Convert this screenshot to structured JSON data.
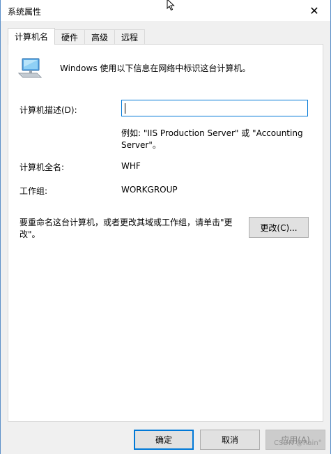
{
  "window": {
    "title": "系统属性",
    "close_glyph": "✕"
  },
  "tabs": [
    {
      "label": "计算机名",
      "active": true
    },
    {
      "label": "硬件",
      "active": false
    },
    {
      "label": "高级",
      "active": false
    },
    {
      "label": "远程",
      "active": false
    }
  ],
  "computer_name_tab": {
    "intro": "Windows 使用以下信息在网络中标识这台计算机。",
    "description_label": "计算机描述(D):",
    "description_value": "",
    "example_text": "例如: \"IIS Production Server\" 或 \"Accounting Server\"。",
    "full_name_label": "计算机全名:",
    "full_name_value": "WHF",
    "workgroup_label": "工作组:",
    "workgroup_value": "WORKGROUP",
    "rename_text": "要重命名这台计算机，或者更改其域或工作组，请单击\"更改\"。",
    "change_button": "更改(C)..."
  },
  "footer": {
    "ok_button": "确定",
    "cancel_button": "取消",
    "apply_button": "应用(A)",
    "apply_enabled": false,
    "watermark": "CSDN @Rain°"
  },
  "colors": {
    "focus_border": "#0078d7",
    "window_border": "#5a8fc9"
  }
}
